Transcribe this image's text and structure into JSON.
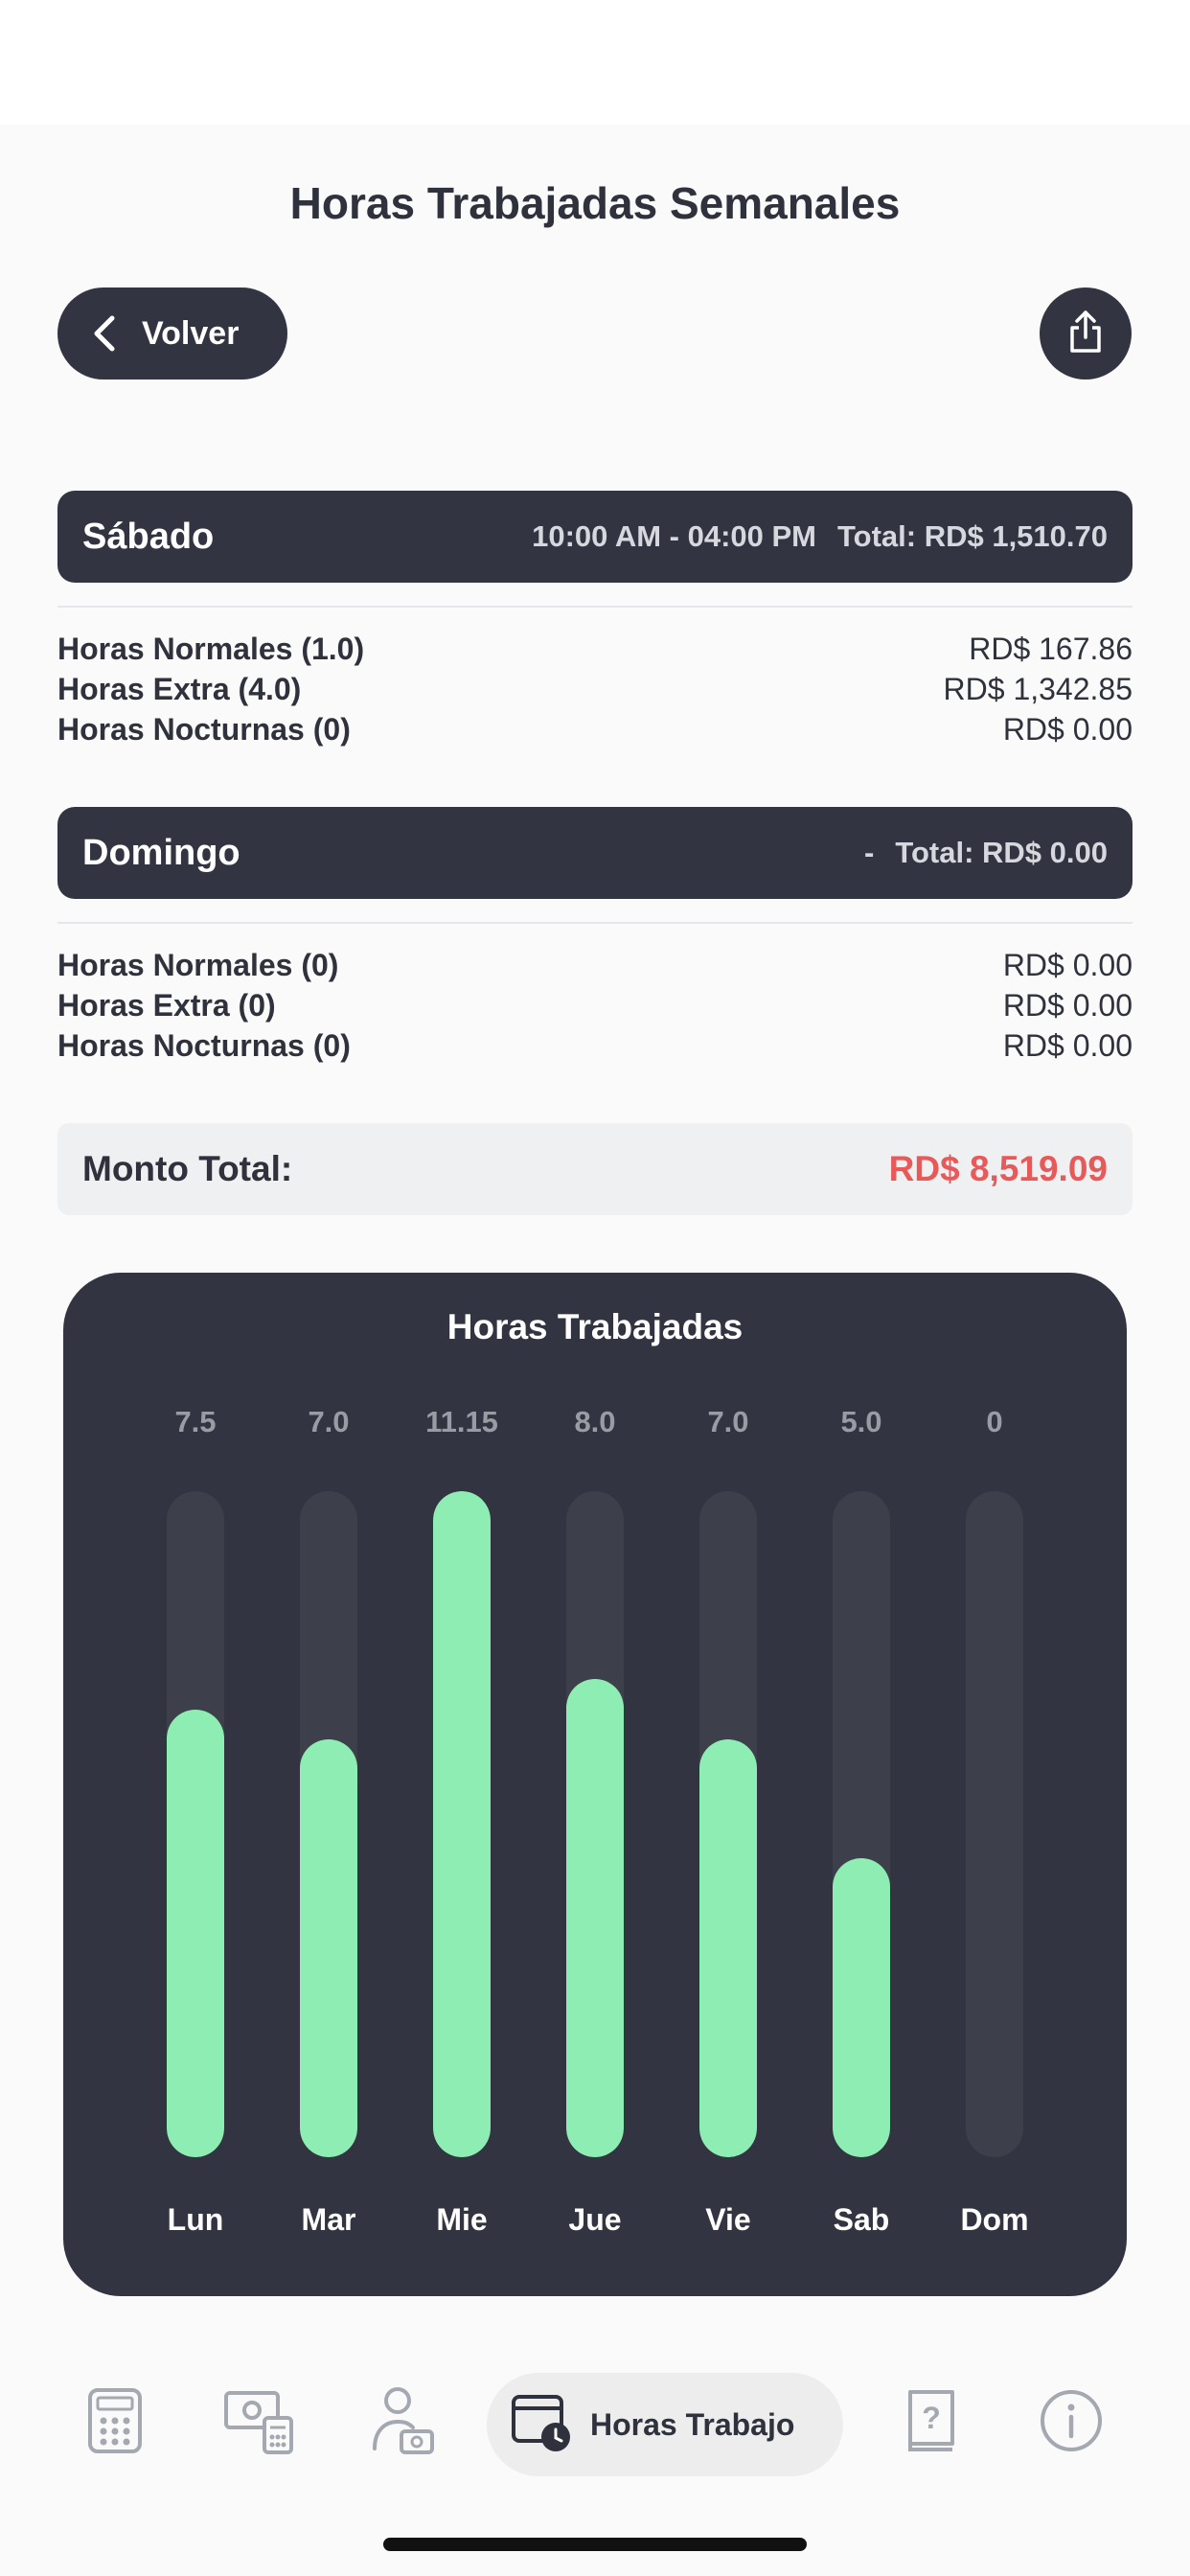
{
  "header": {
    "title": "Horas Trabajadas Semanales",
    "back_label": "Volver"
  },
  "days": [
    {
      "name": "Sábado",
      "range": "10:00 AM - 04:00 PM",
      "total": "Total: RD$ 1,510.70",
      "rows": [
        {
          "label": "Horas Normales (1.0)",
          "value": "RD$ 167.86"
        },
        {
          "label": "Horas Extra (4.0)",
          "value": "RD$ 1,342.85"
        },
        {
          "label": "Horas Nocturnas (0)",
          "value": "RD$ 0.00"
        }
      ]
    },
    {
      "name": "Domingo",
      "range": "-",
      "total": "Total: RD$ 0.00",
      "rows": [
        {
          "label": "Horas Normales (0)",
          "value": "RD$ 0.00"
        },
        {
          "label": "Horas Extra (0)",
          "value": "RD$ 0.00"
        },
        {
          "label": "Horas Nocturnas (0)",
          "value": "RD$ 0.00"
        }
      ]
    }
  ],
  "summary": {
    "label": "Monto Total:",
    "value": "RD$ 8,519.09",
    "value_color": "#e8595a"
  },
  "chart_data": {
    "type": "bar",
    "title": "Horas Trabajadas",
    "categories": [
      "Lun",
      "Mar",
      "Mie",
      "Jue",
      "Vie",
      "Sab",
      "Dom"
    ],
    "values": [
      7.5,
      7.0,
      11.15,
      8.0,
      7.0,
      5.0,
      0
    ],
    "value_labels": [
      "7.5",
      "7.0",
      "11.15",
      "8.0",
      "7.0",
      "5.0",
      "0"
    ],
    "ylim": [
      0,
      11.15
    ],
    "bar_color": "#8eedb2",
    "track_color": "#3d404b"
  },
  "tabbar": {
    "items": [
      {
        "icon": "calculator-icon"
      },
      {
        "icon": "money-calculator-icon"
      },
      {
        "icon": "person-money-icon"
      },
      {
        "icon": "calendar-clock-icon",
        "label": "Horas Trabajo",
        "active": true
      },
      {
        "icon": "help-book-icon"
      },
      {
        "icon": "info-icon"
      }
    ]
  }
}
